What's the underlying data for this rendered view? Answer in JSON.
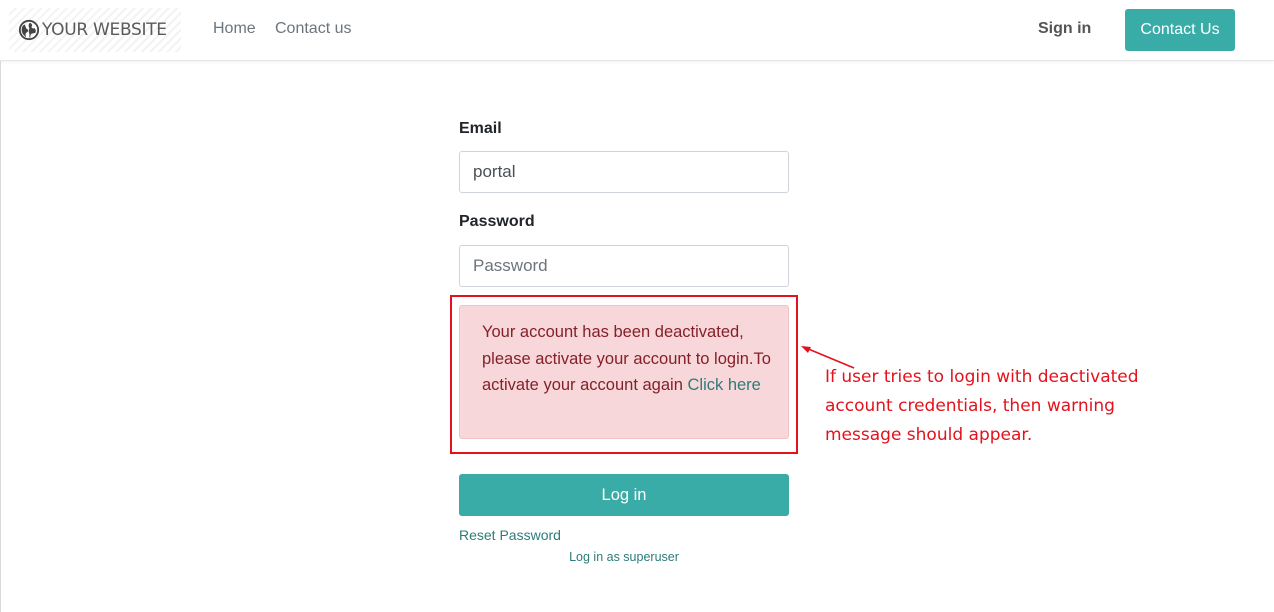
{
  "header": {
    "brand": "YOUR WEBSITE",
    "nav": [
      "Home",
      "Contact us"
    ],
    "signin": "Sign in",
    "contact_button": "Contact Us"
  },
  "form": {
    "email_label": "Email",
    "email_value": "portal",
    "password_label": "Password",
    "password_placeholder": "Password",
    "alert_text": "Your account has been deactivated, please activate your account to login.To activate your account again",
    "alert_link": "Click here",
    "login_button": "Log in",
    "reset_link": "Reset Password",
    "superuser_link": "Log in as superuser"
  },
  "annotation": {
    "text": "If user tries to login with deactivated account credentials, then warning message should appear."
  },
  "colors": {
    "accent": "#3aaca8",
    "alert_bg": "#f8d7da",
    "alert_text": "#842029",
    "annotation": "#e3121c"
  },
  "icons": [
    "globe-icon",
    "arrow-icon"
  ]
}
